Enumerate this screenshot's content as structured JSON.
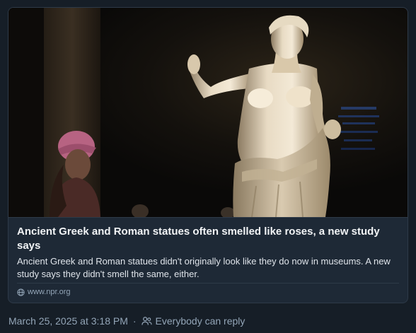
{
  "card": {
    "title": "Ancient Greek and Roman statues often smelled like roses, a new study says",
    "description": "Ancient Greek and Roman statues didn't originally look like they do now in museums. A new study says they didn't smell the same, either.",
    "domain": "www.npr.org",
    "image_icon": "statue-photo"
  },
  "meta": {
    "timestamp": "March 25, 2025 at 3:18 PM",
    "separator": "·",
    "reply_setting": "Everybody can reply",
    "reply_icon": "people-icon"
  },
  "colors": {
    "background": "#161e27",
    "card_background": "#1e2936",
    "border": "#2e3a48",
    "muted_text": "#93a5b7",
    "title_text": "#f1f3f5"
  }
}
